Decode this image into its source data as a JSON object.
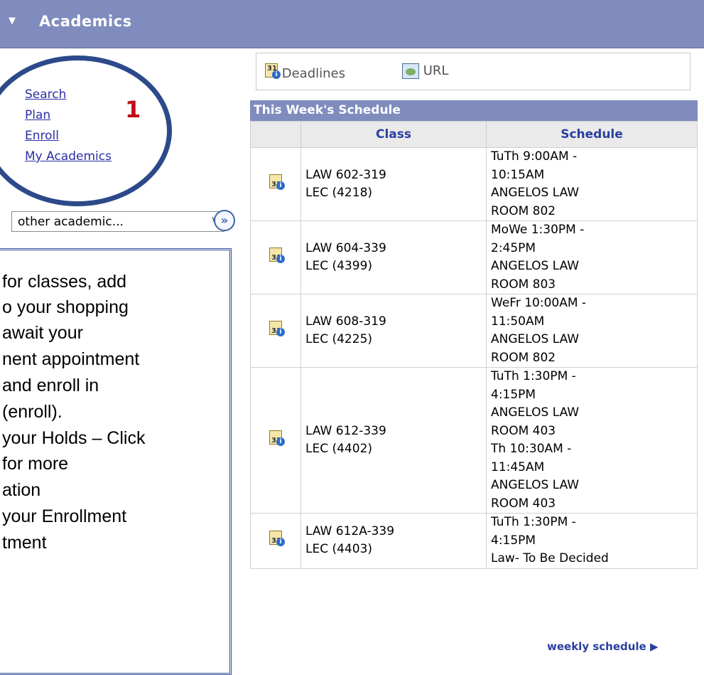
{
  "header": {
    "title": "Academics"
  },
  "nav": {
    "items": [
      "Search",
      "Plan",
      "Enroll",
      "My Academics"
    ]
  },
  "annotation_number": "1",
  "other_select": {
    "value": "other academic..."
  },
  "callout_lines": [
    "for classes, add",
    "o your shopping",
    "await your",
    "nent appointment",
    "and enroll in",
    "(enroll).",
    "your Holds – Click",
    "for more",
    "ation",
    "your Enrollment",
    "tment"
  ],
  "toolbar": {
    "deadlines": "Deadlines",
    "url": "URL"
  },
  "schedule": {
    "title": "This Week's Schedule",
    "col_class": "Class",
    "col_schedule": "Schedule",
    "rows": [
      {
        "class": [
          "LAW 602-319",
          "LEC (4218)"
        ],
        "schedule": [
          "TuTh 9:00AM -",
          "10:15AM",
          "ANGELOS LAW",
          "ROOM 802"
        ]
      },
      {
        "class": [
          "LAW 604-339",
          "LEC (4399)"
        ],
        "schedule": [
          "MoWe 1:30PM -",
          "2:45PM",
          "ANGELOS LAW",
          "ROOM 803"
        ]
      },
      {
        "class": [
          "LAW 608-319",
          "LEC (4225)"
        ],
        "schedule": [
          "WeFr 10:00AM -",
          "11:50AM",
          "ANGELOS LAW",
          "ROOM 802"
        ]
      },
      {
        "class": [
          "LAW 612-339",
          "LEC (4402)"
        ],
        "schedule": [
          "TuTh 1:30PM -",
          "4:15PM",
          "ANGELOS LAW",
          "ROOM 403",
          "Th 10:30AM -",
          "11:45AM",
          "ANGELOS LAW",
          "ROOM 403"
        ]
      },
      {
        "class": [
          "LAW 612A-339",
          "LEC (4403)"
        ],
        "schedule": [
          "TuTh 1:30PM -",
          "4:15PM",
          "Law- To Be Decided"
        ]
      }
    ],
    "weekly_link": "weekly schedule"
  }
}
